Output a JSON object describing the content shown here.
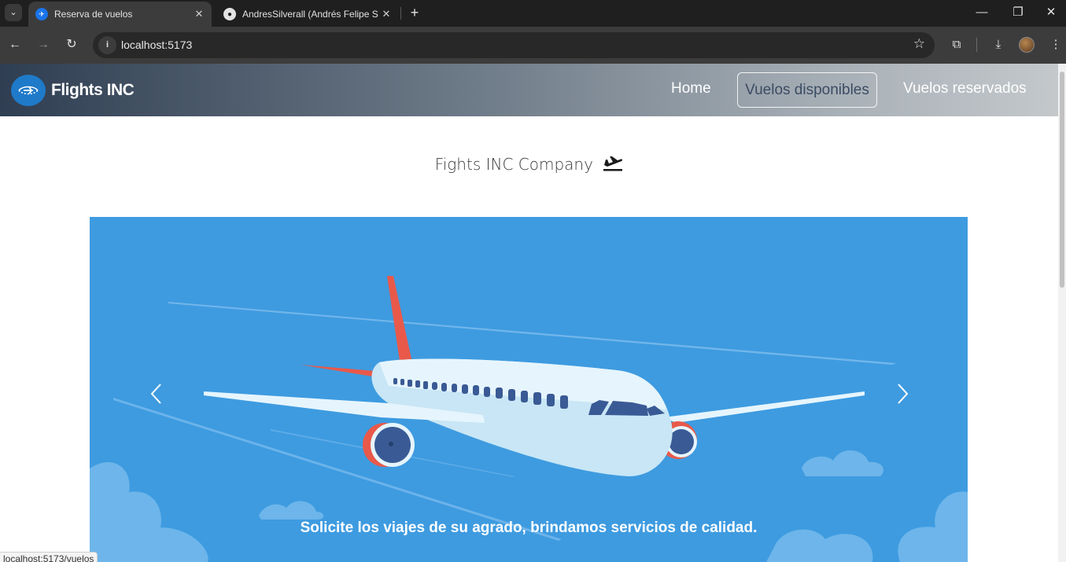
{
  "browser": {
    "tabs": [
      {
        "title": "Reserva de vuelos",
        "active": true
      },
      {
        "title": "AndresSilverall (Andrés Felipe S",
        "active": false
      }
    ],
    "url": "localhost:5173",
    "status_url": "localhost:5173/vuelos"
  },
  "navbar": {
    "brand": "Flights INC",
    "links": [
      "Home",
      "Vuelos disponibles",
      "Vuelos reservados"
    ]
  },
  "page": {
    "company_title": "Fights INC Company",
    "carousel_caption": "Solicite los viajes de su agrado, brindamos servicios de calidad."
  },
  "colors": {
    "carousel_bg": "#3e9be0",
    "accent": "#1f7ac9"
  },
  "icons": {
    "tab_list": "chevron-down-icon",
    "back": "arrow-left-icon",
    "forward": "arrow-right-icon",
    "reload": "reload-icon",
    "bookmark": "star-icon",
    "extensions": "puzzle-icon",
    "downloads": "download-icon",
    "menu": "kebab-icon",
    "company": "plane-departure-icon"
  }
}
